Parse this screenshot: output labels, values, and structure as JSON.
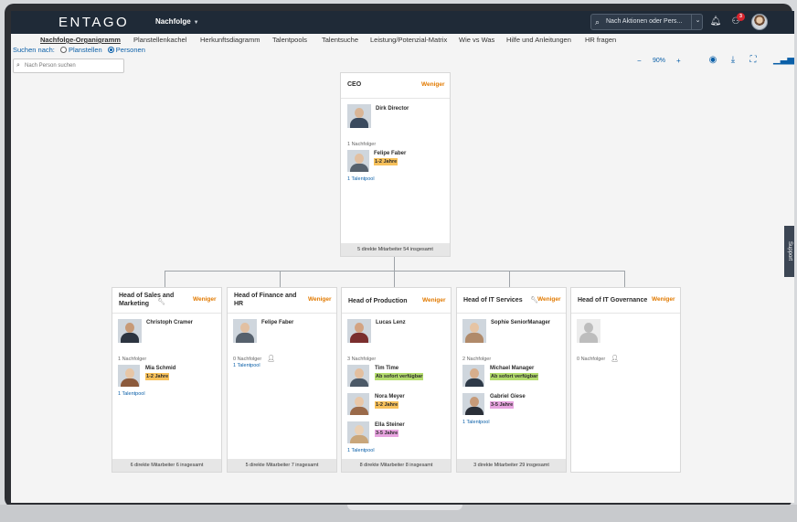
{
  "app": {
    "brand": "ENTAGO",
    "module": "Nachfolge"
  },
  "topbar": {
    "search_placeholder": "Nach Aktionen oder Pers...",
    "notification_count": "3"
  },
  "nav": {
    "items": [
      "Nachfolge-Organigramm",
      "Planstellenkachel",
      "Herkunftsdiagramm",
      "Talentpools",
      "Talentsuche",
      "Leistung/Potenzial-Matrix",
      "Wie vs Was",
      "Hilfe und Anleitungen",
      "HR fragen"
    ],
    "active": "Nachfolge-Organigramm"
  },
  "filters": {
    "search_by_label": "Suchen nach:",
    "option_positions": "Planstellen",
    "option_persons": "Personen",
    "selected": "Personen",
    "person_search_placeholder": "Nach Person suchen"
  },
  "toolbar": {
    "zoom_out": "−",
    "zoom": "90%",
    "zoom_in": "+"
  },
  "support_label": "Support",
  "ceo": {
    "title": "CEO",
    "toggle": "Weniger",
    "holder": "Dirk Director",
    "successor_count": "1 Nachfolger",
    "successor": {
      "name": "Felipe Faber",
      "readiness": "1-2 Jahre"
    },
    "talent_pool": "1 Talentpool",
    "footer": "5 direkte Mitarbeiter 54 insgesamt"
  },
  "positions": [
    {
      "title": "Head of Sales and Marketing",
      "toggle": "Weniger",
      "holder": "Christoph Cramer",
      "successor_count": "1 Nachfolger",
      "successors": [
        {
          "name": "Mia Schmid",
          "readiness": "1-2 Jahre"
        }
      ],
      "talent_pool": "1 Talentpool",
      "footer": "6 direkte Mitarbeiter 6 insgesamt"
    },
    {
      "title": "Head of Finance and HR",
      "toggle": "Weniger",
      "holder": "Felipe Faber",
      "successor_count": "0 Nachfolger",
      "successors": [],
      "talent_pool": "1 Talentpool",
      "footer": "5 direkte Mitarbeiter 7 insgesamt"
    },
    {
      "title": "Head of Production",
      "toggle": "Weniger",
      "holder": "Lucas Lenz",
      "successor_count": "3 Nachfolger",
      "successors": [
        {
          "name": "Tim Time",
          "readiness": "Ab sofort verfügbar"
        },
        {
          "name": "Nora Meyer",
          "readiness": "1-2 Jahre"
        },
        {
          "name": "Ella Steiner",
          "readiness": "3-5 Jahre"
        }
      ],
      "talent_pool": "1 Talentpool",
      "footer": "8 direkte Mitarbeiter 8 insgesamt"
    },
    {
      "title": "Head of IT Services",
      "toggle": "Weniger",
      "holder": "Sophie SeniorManager",
      "successor_count": "2 Nachfolger",
      "successors": [
        {
          "name": "Michael Manager",
          "readiness": "Ab sofort verfügbar"
        },
        {
          "name": "Gabriel Giese",
          "readiness": "3-5 Jahre"
        }
      ],
      "talent_pool": "1 Talentpool",
      "footer": "3 direkte Mitarbeiter 29 insgesamt"
    },
    {
      "title": "Head of IT Governance",
      "toggle": "Weniger",
      "holder": "",
      "successor_count": "0 Nachfolger",
      "successors": [],
      "talent_pool": "",
      "footer": ""
    }
  ],
  "colors": {
    "accent": "#e27a00",
    "link": "#0a5fa8",
    "topbar": "#1f2a37",
    "ready_now": "#b4dc6d",
    "one_two_years": "#f7c15b",
    "three_five_years": "#e7a4df"
  }
}
